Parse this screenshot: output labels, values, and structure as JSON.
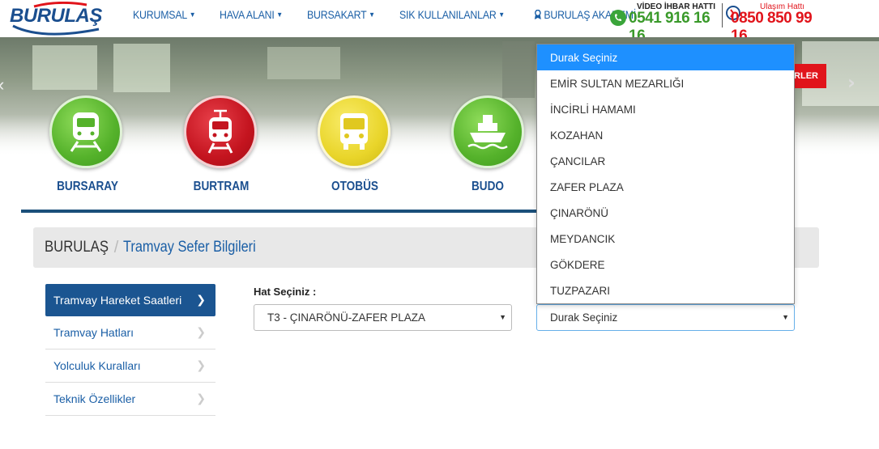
{
  "header": {
    "logo_text": "BURULAŞ",
    "nav": [
      {
        "label": "KURUMSAL",
        "icon": "chevron-down-icon"
      },
      {
        "label": "HAVA ALANI",
        "icon": "chevron-down-icon"
      },
      {
        "label": "BURSAKART",
        "icon": "chevron-down-icon"
      },
      {
        "label": "SIK KULLANILANLAR",
        "icon": "chevron-down-icon"
      },
      {
        "label": "BURULAŞ AKADEMİ",
        "icon": "graduation-icon"
      }
    ],
    "hotline1_label": "VİDEO İHBAR HATTI",
    "hotline1_number": "0541 916 16 16",
    "hotline2_label": "Ulaşım Hattı",
    "hotline2_number": "0850 850 99 16"
  },
  "hero": {
    "button_label": "ERLER",
    "modes": [
      {
        "label": "BURSARAY",
        "color": "#55b22b",
        "icon": "train-icon"
      },
      {
        "label": "BURTRAM",
        "color": "#c4141f",
        "icon": "tram-icon"
      },
      {
        "label": "OTOBÜS",
        "color": "#e9d52a",
        "icon": "bus-icon"
      },
      {
        "label": "BUDO",
        "color": "#55b22b",
        "icon": "ship-icon"
      }
    ]
  },
  "breadcrumb": {
    "home": "BURULAŞ",
    "separator": "/",
    "current": "Tramvay Sefer Bilgileri"
  },
  "sidebar": {
    "items": [
      {
        "label": "Tramvay Hareket Saatleri",
        "active": true
      },
      {
        "label": "Tramvay Hatları",
        "active": false
      },
      {
        "label": "Yolculuk Kuralları",
        "active": false
      },
      {
        "label": "Teknik Özellikler",
        "active": false
      }
    ]
  },
  "form": {
    "line_label": "Hat Seçiniz :",
    "line_value": "T3 - ÇINARÖNÜ-ZAFER PLAZA",
    "stop_value": "Durak Seçiniz",
    "stop_options": [
      "Durak Seçiniz",
      "EMİR SULTAN MEZARLIĞI",
      "İNCİRLİ HAMAMI",
      "KOZAHAN",
      "ÇANCILAR",
      "ZAFER PLAZA",
      "ÇINARÖNÜ",
      "MEYDANCIK",
      "GÖKDERE",
      "TUZPAZARI"
    ],
    "highlighted_option": 0
  }
}
